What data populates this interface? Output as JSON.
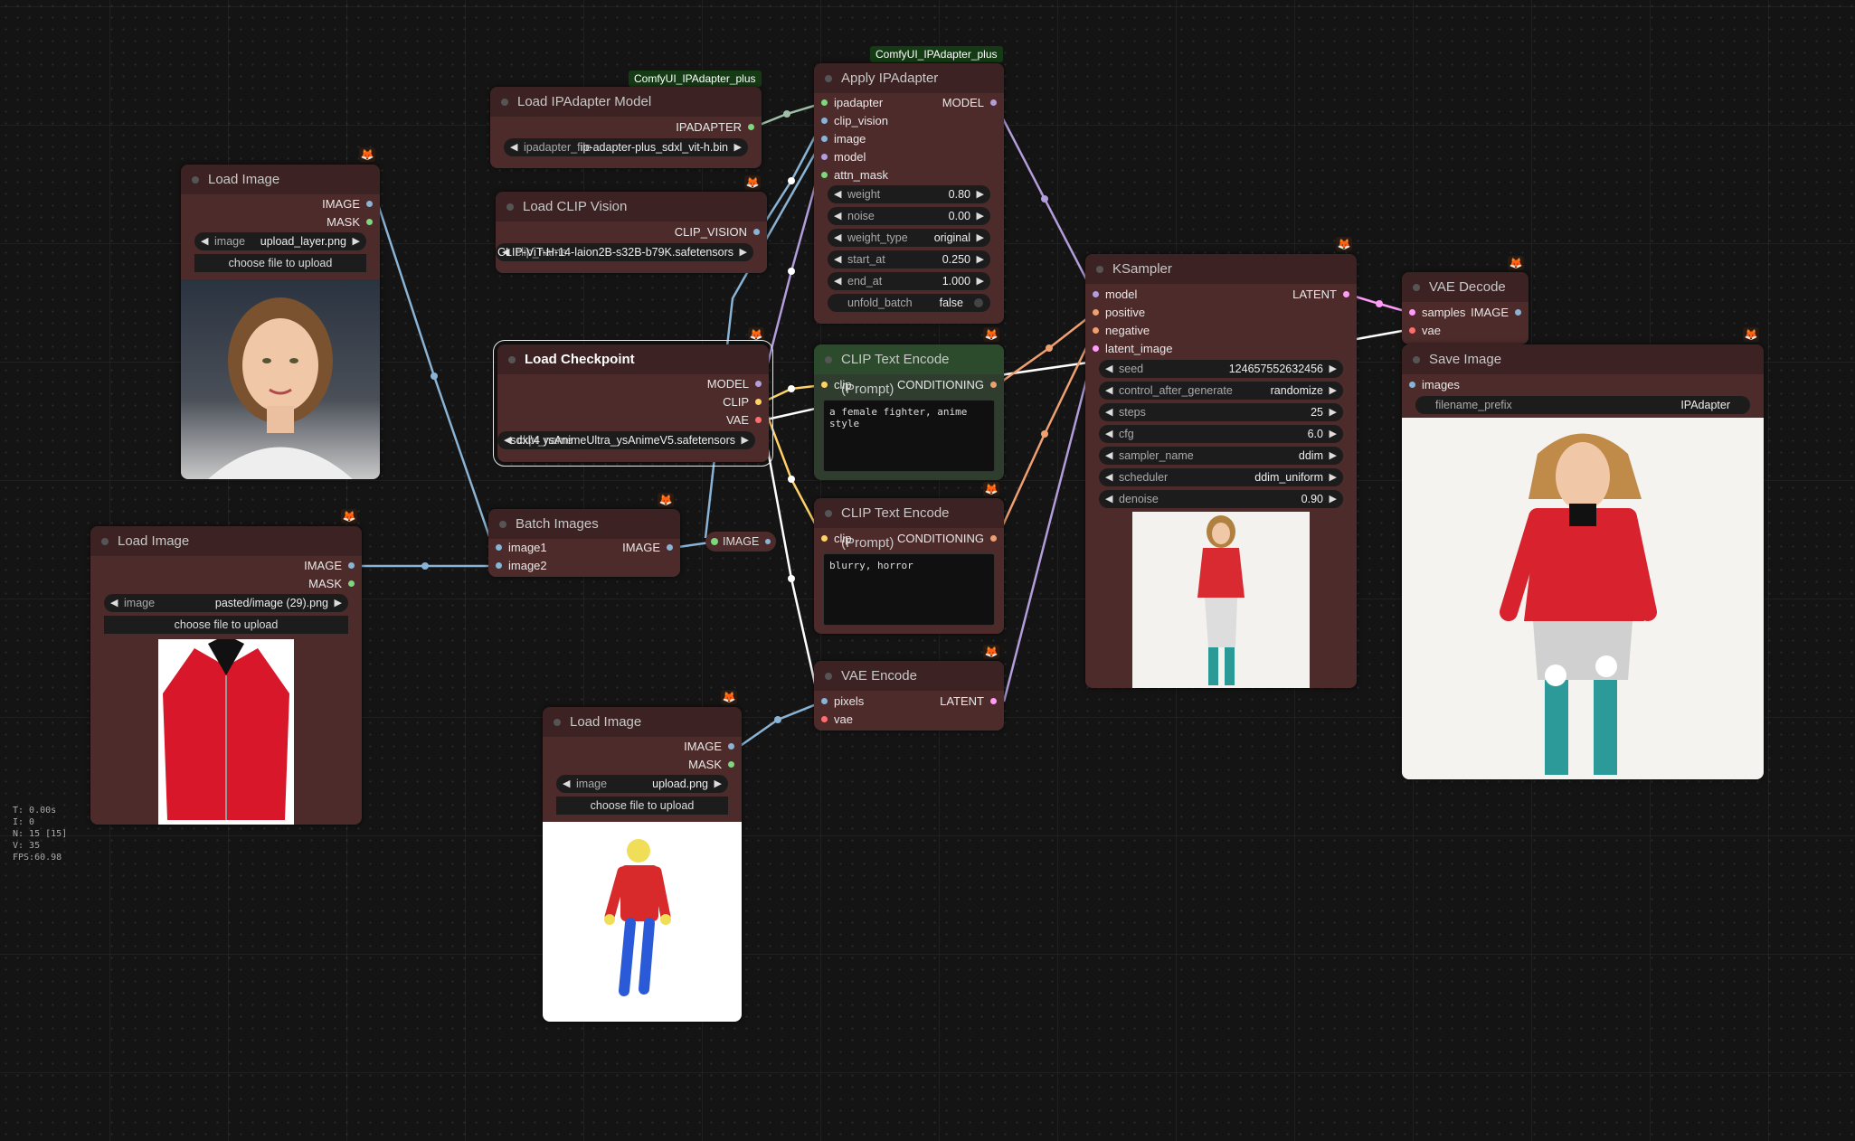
{
  "canvas": {
    "stats": [
      "T: 0.00s",
      "I: 0",
      "N: 15 [15]",
      "V: 35",
      "FPS:60.98"
    ]
  },
  "badges": {
    "ipadapter_plus_1": "ComfyUI_IPAdapter_plus",
    "ipadapter_plus_2": "ComfyUI_IPAdapter_plus"
  },
  "icons": {
    "node_pack": "fox-icon",
    "slot": "dot"
  },
  "colors": {
    "node_bg": "#4d2b2b",
    "node_header": "#3c2222",
    "green_node_bg": "#2f3d2f",
    "wire_image": "#8ab4d6",
    "wire_model": "#b39ddb",
    "wire_clip": "#ffd166",
    "wire_conditioning": "#f0a070",
    "wire_latent": "#ff9cf9",
    "wire_vae": "#ff6e6e"
  },
  "nodes": {
    "load_image_1": {
      "title": "Load Image",
      "out_image": "IMAGE",
      "out_mask": "MASK",
      "w_label": "image",
      "w_value": "upload_layer.png",
      "button": "choose file to upload"
    },
    "load_image_2": {
      "title": "Load Image",
      "out_image": "IMAGE",
      "out_mask": "MASK",
      "w_label": "image",
      "w_value": "pasted/image (29).png",
      "button": "choose file to upload"
    },
    "load_image_3": {
      "title": "Load Image",
      "out_image": "IMAGE",
      "out_mask": "MASK",
      "w_label": "image",
      "w_value": "upload.png",
      "button": "choose file to upload"
    },
    "load_ipadapter_model": {
      "title": "Load IPAdapter Model",
      "out": "IPADAPTER",
      "w_label": "ipadapter_file",
      "w_value": "ip-adapter-plus_sdxl_vit-h.bin"
    },
    "load_clip_vision": {
      "title": "Load CLIP Vision",
      "out": "CLIP_VISION",
      "w_label": "clip_name",
      "w_value": "CLIP-ViT-H-14-laion2B-s32B-b79K.safetensors"
    },
    "load_checkpoint": {
      "title": "Load Checkpoint",
      "out_model": "MODEL",
      "out_clip": "CLIP",
      "out_vae": "VAE",
      "w_label": "ckpt_name",
      "w_value": "sdxl\\4 ysAnimeUltra_ysAnimeV5.safetensors"
    },
    "batch_images": {
      "title": "Batch Images",
      "in1": "image1",
      "in2": "image2",
      "out": "IMAGE"
    },
    "reroute": {
      "label": "IMAGE"
    },
    "apply_ipadapter": {
      "title": "Apply IPAdapter",
      "inputs": [
        "ipadapter",
        "clip_vision",
        "image",
        "model",
        "attn_mask"
      ],
      "out": "MODEL",
      "widgets": [
        {
          "label": "weight",
          "value": "0.80"
        },
        {
          "label": "noise",
          "value": "0.00"
        },
        {
          "label": "weight_type",
          "value": "original"
        },
        {
          "label": "start_at",
          "value": "0.250"
        },
        {
          "label": "end_at",
          "value": "1.000"
        }
      ],
      "toggle_label": "unfold_batch",
      "toggle_value": "false"
    },
    "clip_text_pos": {
      "title": "CLIP Text Encode (Prompt)",
      "in": "clip",
      "out": "CONDITIONING",
      "text": "a female fighter, anime style"
    },
    "clip_text_neg": {
      "title": "CLIP Text Encode (Prompt)",
      "in": "clip",
      "out": "CONDITIONING",
      "text": "blurry, horror"
    },
    "vae_encode": {
      "title": "VAE Encode",
      "in1": "pixels",
      "in2": "vae",
      "out": "LATENT"
    },
    "ksampler": {
      "title": "KSampler",
      "inputs": [
        "model",
        "positive",
        "negative",
        "latent_image"
      ],
      "out": "LATENT",
      "widgets": [
        {
          "label": "seed",
          "value": "124657552632456"
        },
        {
          "label": "control_after_generate",
          "value": "randomize"
        },
        {
          "label": "steps",
          "value": "25"
        },
        {
          "label": "cfg",
          "value": "6.0"
        },
        {
          "label": "sampler_name",
          "value": "ddim"
        },
        {
          "label": "scheduler",
          "value": "ddim_uniform"
        },
        {
          "label": "denoise",
          "value": "0.90"
        }
      ]
    },
    "vae_decode": {
      "title": "VAE Decode",
      "in1": "samples",
      "in2": "vae",
      "out": "IMAGE"
    },
    "save_image": {
      "title": "Save Image",
      "in": "images",
      "w_label": "filename_prefix",
      "w_value": "IPAdapter"
    }
  }
}
